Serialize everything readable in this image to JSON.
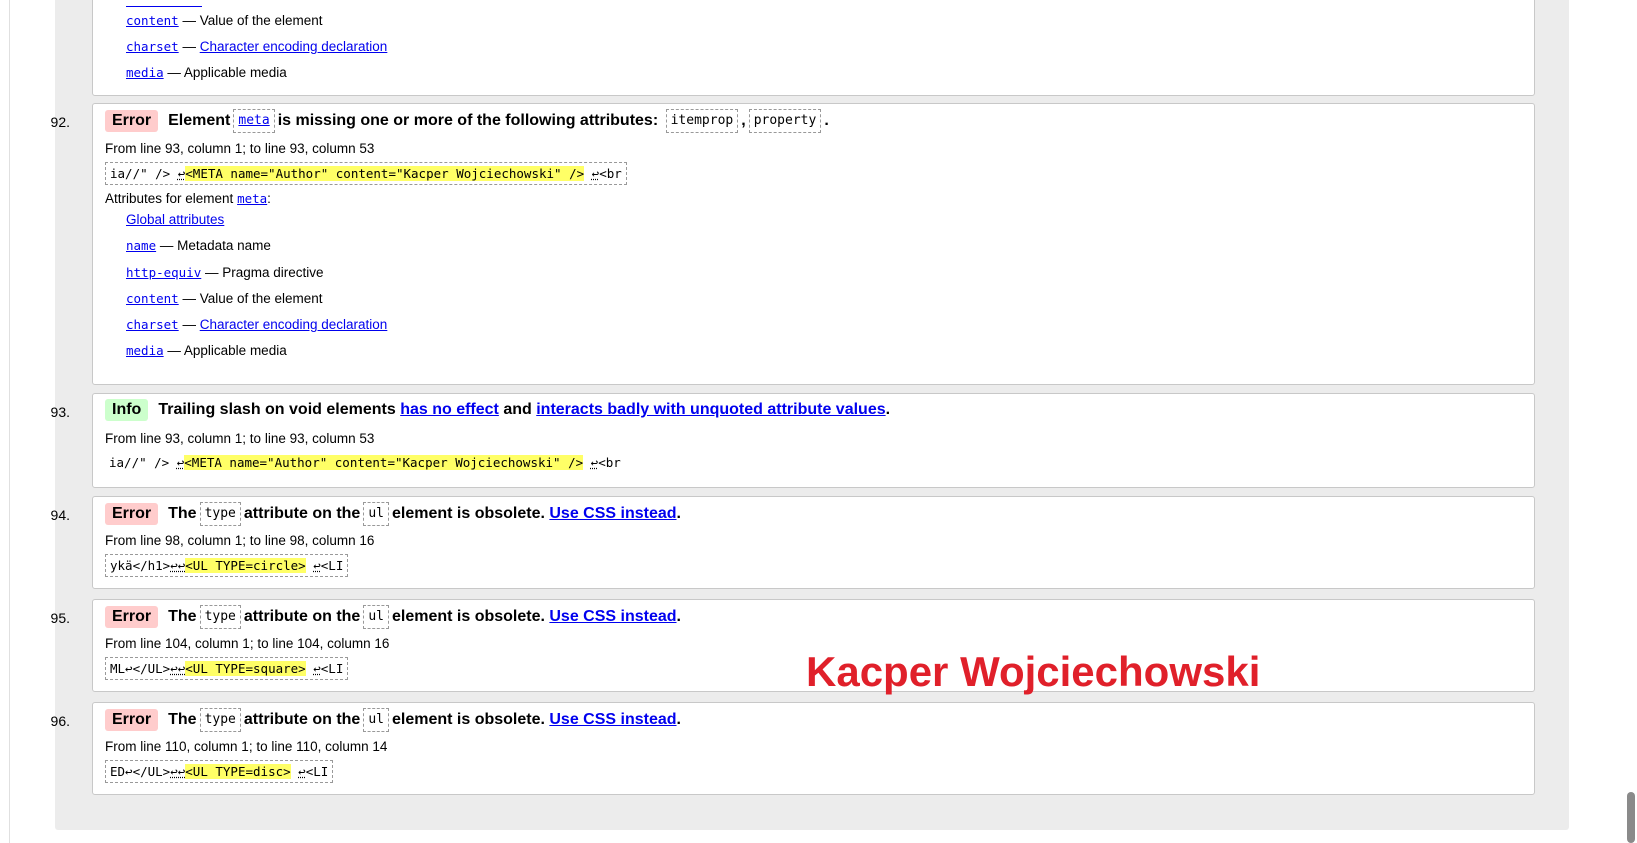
{
  "msg91_tail": {
    "attrs": [
      {
        "name": "content",
        "desc": " — Value of the element",
        "link": ""
      },
      {
        "name": "charset",
        "desc": " — ",
        "link": "Character encoding declaration"
      },
      {
        "name": "media",
        "desc": " — Applicable media",
        "link": ""
      }
    ]
  },
  "msg92": {
    "num": "92.",
    "type": "Error",
    "t1": "Element",
    "el": "meta",
    "t2": "is missing one or more of the following attributes:",
    "a1": "itemprop",
    "sep": ",",
    "a2": "property",
    "end": ".",
    "location": "From line 93, column 1; to line 93, column 53",
    "ex_pre": "ia//\" /> ",
    "ex_ret": "↩",
    "ex_hl": "<META name=\"Author\" content=\"Kacper Wojciechowski\" />",
    "ex_post_ret": "↩",
    "ex_post": "<br",
    "attr_head": "Attributes for element ",
    "attr_head_el": "meta",
    "attr_head_end": ":",
    "global": "Global attributes",
    "attrs": [
      {
        "name": "name",
        "desc": " — Metadata name",
        "link": ""
      },
      {
        "name": "http-equiv",
        "desc": " — Pragma directive",
        "link": ""
      },
      {
        "name": "content",
        "desc": " — Value of the element",
        "link": ""
      },
      {
        "name": "charset",
        "desc": " — ",
        "link": "Character encoding declaration"
      },
      {
        "name": "media",
        "desc": " — Applicable media",
        "link": ""
      }
    ]
  },
  "msg93": {
    "num": "93.",
    "type": "Info",
    "t1": "Trailing slash on void elements",
    "l1": "has no effect",
    "t2": "and",
    "l2": "interacts badly with unquoted attribute values",
    "end": ".",
    "location": "From line 93, column 1; to line 93, column 53",
    "ex_pre": "ia//\" /> ",
    "ex_ret": "↩",
    "ex_hl": "<META name=\"Author\" content=\"Kacper Wojciechowski\" />",
    "ex_post_ret": "↩",
    "ex_post": "<br"
  },
  "msg94": {
    "num": "94.",
    "type": "Error",
    "t1": "The",
    "a": "type",
    "t2": "attribute on the",
    "el": "ul",
    "t3": "element is obsolete.",
    "link": "Use CSS instead",
    "end": ".",
    "location": "From line 98, column 1; to line 98, column 16",
    "ex_pre": "ykä</h1>",
    "ex_ret": "↩↩",
    "ex_hl": "<UL TYPE=circle>",
    "ex_post_ret": "↩",
    "ex_post": "<LI"
  },
  "msg95": {
    "num": "95.",
    "type": "Error",
    "t1": "The",
    "a": "type",
    "t2": "attribute on the",
    "el": "ul",
    "t3": "element is obsolete.",
    "link": "Use CSS instead",
    "end": ".",
    "location": "From line 104, column 1; to line 104, column 16",
    "ex_pre": "ML↩</UL>",
    "ex_ret": "↩↩",
    "ex_hl": "<UL TYPE=square>",
    "ex_post_ret": "↩",
    "ex_post": "<LI"
  },
  "msg96": {
    "num": "96.",
    "type": "Error",
    "t1": "The",
    "a": "type",
    "t2": "attribute on the",
    "el": "ul",
    "t3": "element is obsolete.",
    "link": "Use CSS instead",
    "end": ".",
    "location": "From line 110, column 1; to line 110, column 14",
    "ex_pre": "ED↩</UL>",
    "ex_ret": "↩↩",
    "ex_hl": "<UL TYPE=disc>",
    "ex_post_ret": "↩",
    "ex_post": "<LI"
  },
  "watermark": "Kacper Wojciechowski"
}
